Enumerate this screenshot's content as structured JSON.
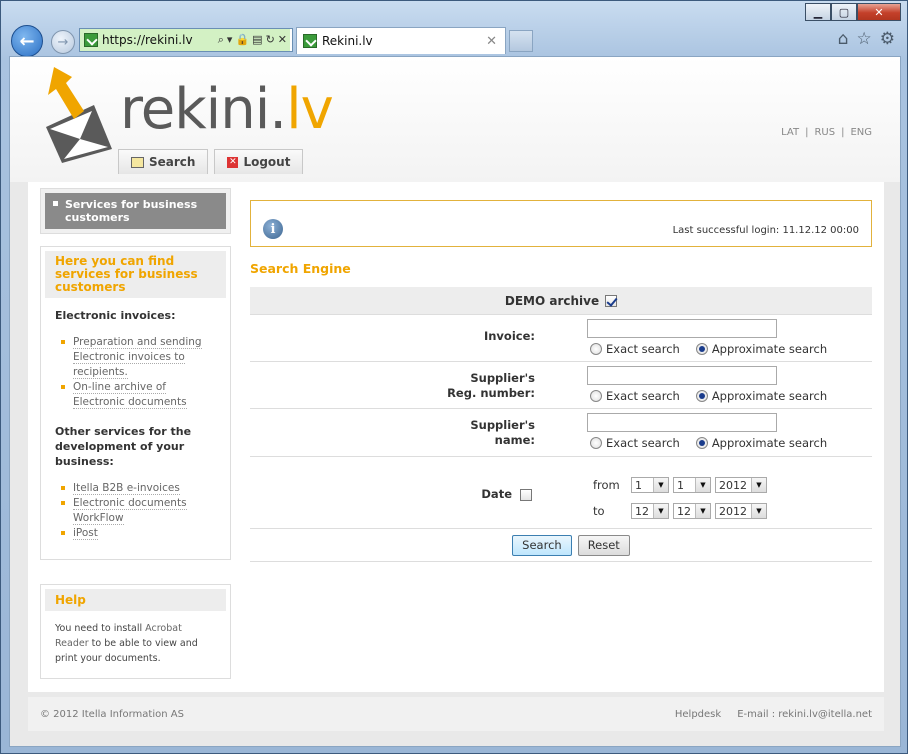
{
  "browser": {
    "address_url": "https://rekini.lv",
    "tab_title": "Rekini.lv"
  },
  "site": {
    "logo_main": "rekini.",
    "logo_accent": "lv",
    "languages": [
      "LAT",
      "RUS",
      "ENG"
    ],
    "nav": {
      "search": "Search",
      "logout": "Logout"
    }
  },
  "sidebar": {
    "services_label": "Services for business customers",
    "info_title": "Here you can find services for business customers",
    "electronic_title": "Electronic invoices:",
    "electronic_links": [
      "Preparation and sending Electronic invoices to recipients.",
      "On-line archive of Electronic documents"
    ],
    "other_title": "Other services for the development of your business:",
    "other_links": [
      "Itella B2B e-invoices",
      "Electronic documents WorkFlow",
      "iPost"
    ],
    "help_title": "Help",
    "help_text_1": "You need to install ",
    "help_link": "Acrobat Reader",
    "help_text_2": " to be able to view and print your documents."
  },
  "login": {
    "last_login": "Last successful login: 11.12.12 00:00"
  },
  "search": {
    "title": "Search Engine",
    "demo_label": "DEMO archive",
    "invoice_label": "Invoice:",
    "supplier_reg_label_1": "Supplier's",
    "supplier_reg_label_2": "Reg. number:",
    "supplier_name_label_1": "Supplier's",
    "supplier_name_label_2": "name:",
    "exact": "Exact search",
    "approx": "Approximate search",
    "date_label": "Date",
    "from": "from",
    "to": "to",
    "from_day": "1",
    "from_month": "1",
    "from_year": "2012",
    "to_day": "12",
    "to_month": "12",
    "to_year": "2012",
    "search_btn": "Search",
    "reset_btn": "Reset"
  },
  "footer": {
    "copyright": "© 2012 Itella Information AS",
    "helpdesk": "Helpdesk",
    "email": "E-mail : rekini.lv@itella.net"
  },
  "colors": {
    "accent": "#f0a500",
    "logo_gray": "#5a5a5a"
  }
}
